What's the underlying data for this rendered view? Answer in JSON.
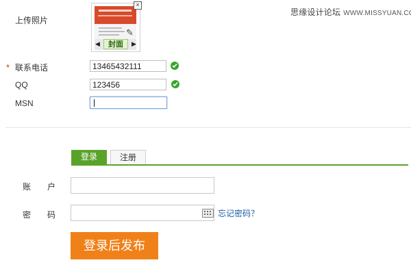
{
  "watermark": {
    "text": "思缘设计论坛",
    "url": "WWW.MISSYUAN.COM"
  },
  "upload": {
    "label": "上传照片",
    "cover_label": "封面",
    "close_glyph": "×",
    "prev_glyph": "◀",
    "next_glyph": "▶",
    "edit_glyph": "✎"
  },
  "form": {
    "required_mark": "*",
    "phone": {
      "label": "联系电话",
      "value": "13465432111"
    },
    "qq": {
      "label": "QQ",
      "value": "123456"
    },
    "msn": {
      "label": "MSN",
      "value": ""
    }
  },
  "login": {
    "tabs": [
      {
        "label": "登录",
        "active": true
      },
      {
        "label": "注册",
        "active": false
      }
    ],
    "account_label": "账　　户",
    "password_label": "密　　码",
    "forgot_link": "忘记密码？",
    "submit_label": "登录后发布"
  },
  "colors": {
    "accent_green": "#5aa32a",
    "submit_orange": "#f08119",
    "link_blue": "#1a5ea8",
    "required_red": "#d8301d"
  }
}
